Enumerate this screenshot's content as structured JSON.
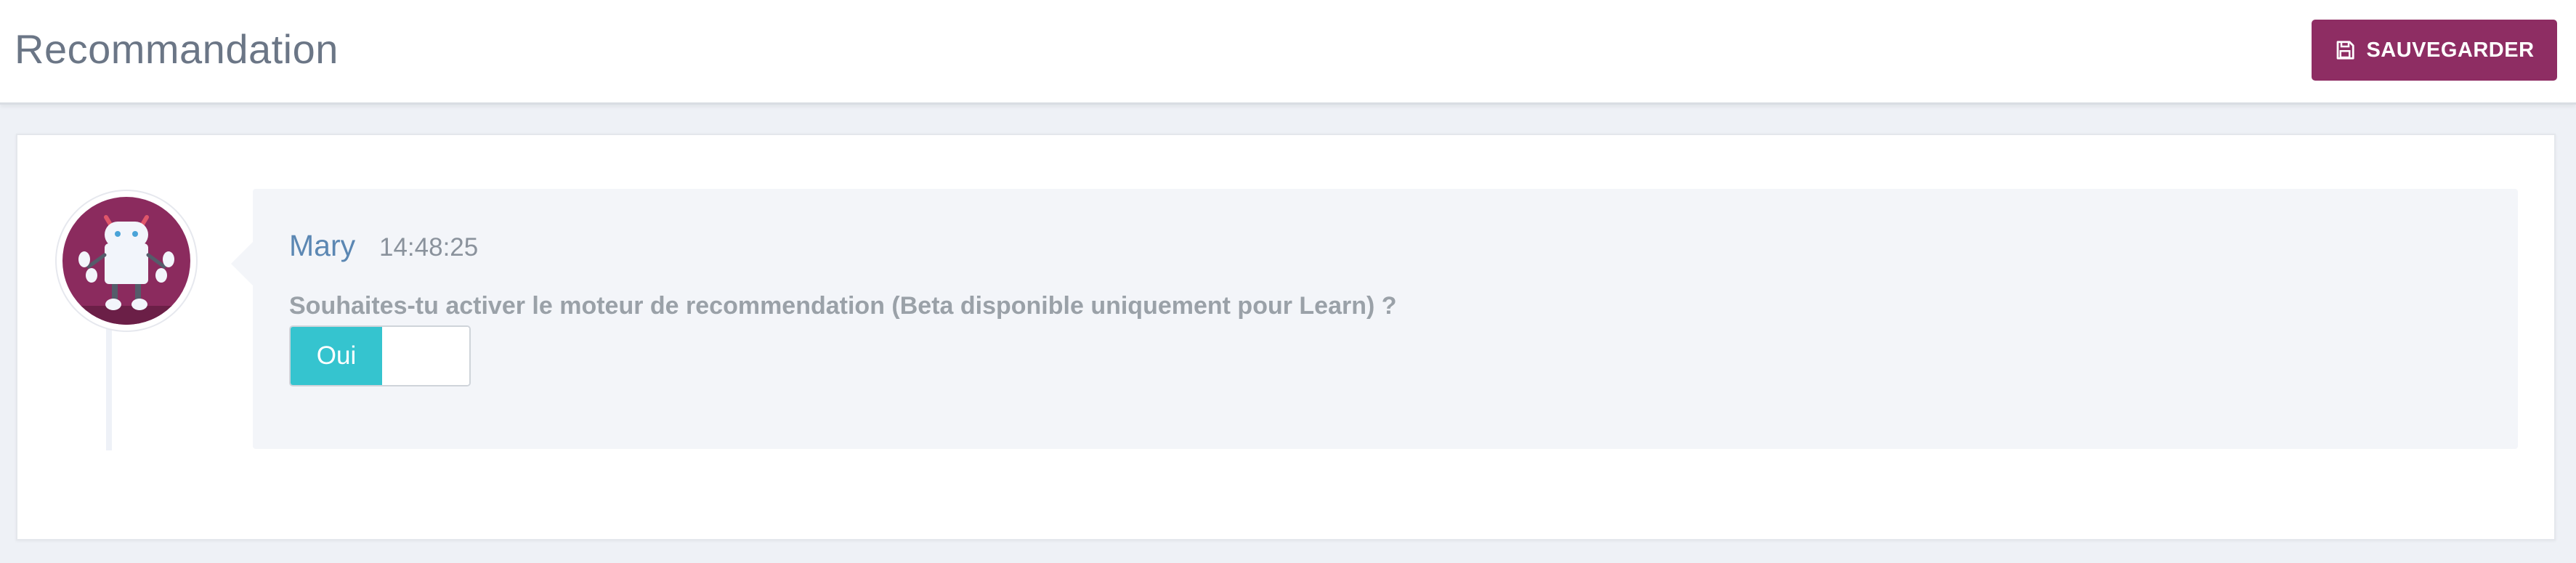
{
  "header": {
    "title": "Recommandation",
    "save_label": "SAUVEGARDER"
  },
  "message": {
    "author": "Mary",
    "time": "14:48:25",
    "question": "Souhaites-tu activer le moteur de recommendation (Beta disponible uniquement pour Learn) ?"
  },
  "toggle": {
    "on_label": "Oui",
    "state": "on"
  },
  "colors": {
    "brand": "#8e2d63",
    "toggle_on": "#35c4cf",
    "author": "#5b87b3"
  },
  "icons": {
    "save": "floppy-disk-icon",
    "avatar": "robot-icon"
  }
}
